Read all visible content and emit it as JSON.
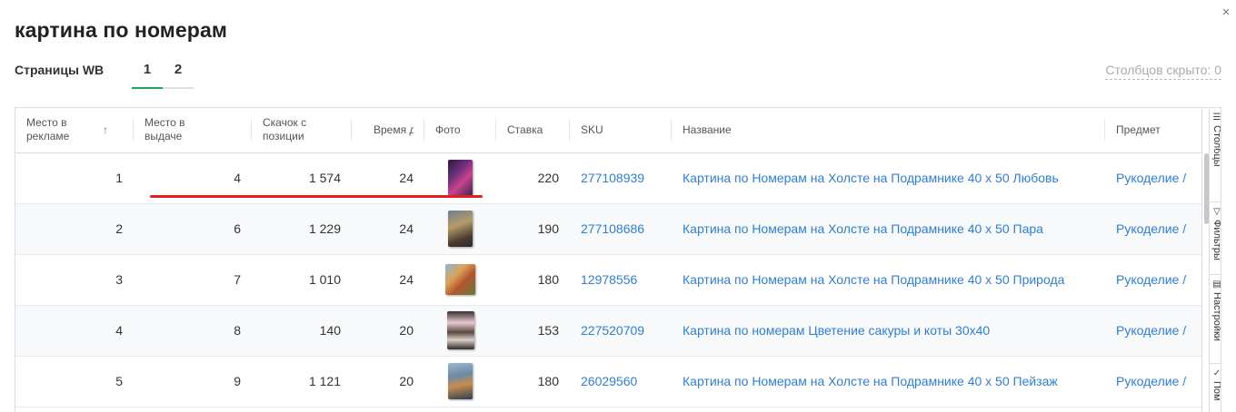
{
  "title": "картина по номерам",
  "close_icon": "×",
  "pages": {
    "label": "Страницы WB",
    "tabs": [
      {
        "label": "1",
        "active": true
      },
      {
        "label": "2",
        "active": false
      }
    ]
  },
  "hidden_columns_label": "Столбцов скрыто: 0",
  "columns": {
    "ad_place": "Место в рекламе",
    "ad_sort_icon": "↑",
    "search_place": "Место в выдаче",
    "jump": "Скачок с позиции",
    "delivery": "Время достав",
    "photo": "Фото",
    "bid": "Ставка",
    "sku": "SKU",
    "name": "Название",
    "subject": "Предмет"
  },
  "rows": [
    {
      "ad_place": "1",
      "search_place": "4",
      "jump": "1 574",
      "delivery": "24",
      "photo_icon": "painting-thumbnail",
      "bid": "220",
      "sku": "277108939",
      "name": "Картина по Номерам на Холсте на Подрамнике 40 х 50 Любовь",
      "subject": "Рукоделие /"
    },
    {
      "ad_place": "2",
      "search_place": "6",
      "jump": "1 229",
      "delivery": "24",
      "photo_icon": "painting-thumbnail",
      "bid": "190",
      "sku": "277108686",
      "name": "Картина по Номерам на Холсте на Подрамнике 40 х 50 Пара",
      "subject": "Рукоделие /"
    },
    {
      "ad_place": "3",
      "search_place": "7",
      "jump": "1 010",
      "delivery": "24",
      "photo_icon": "painting-thumbnail",
      "bid": "180",
      "sku": "12978556",
      "name": "Картина по Номерам на Холсте на Подрамнике 40 х 50 Природа",
      "subject": "Рукоделие /"
    },
    {
      "ad_place": "4",
      "search_place": "8",
      "jump": "140",
      "delivery": "20",
      "photo_icon": "painting-thumbnail",
      "bid": "153",
      "sku": "227520709",
      "name": "Картина по номерам Цветение сакуры и коты 30х40",
      "subject": "Рукоделие /"
    },
    {
      "ad_place": "5",
      "search_place": "9",
      "jump": "1 121",
      "delivery": "20",
      "photo_icon": "painting-thumbnail",
      "bid": "180",
      "sku": "26029560",
      "name": "Картина по Номерам на Холсте на Подрамнике 40 х 50 Пейзаж",
      "subject": "Рукоделие /"
    }
  ],
  "side_tabs": {
    "columns_icon": "☰",
    "columns": "Столбцы",
    "filters_icon": "▽",
    "filters": "Фильтры",
    "settings_icon": "▤",
    "settings": "Настройки",
    "help_icon": "✓",
    "help": "Пом"
  },
  "colors": {
    "accent_green": "#24a45a",
    "link_blue": "#2f7fd0",
    "highlight_red": "#e02020"
  }
}
